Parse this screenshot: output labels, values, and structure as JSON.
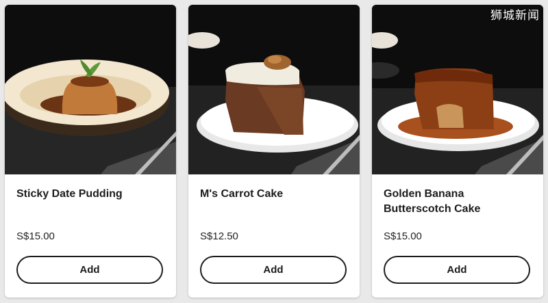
{
  "watermark": "狮城新闻",
  "products": [
    {
      "name": "Sticky Date Pudding",
      "price": "S$15.00",
      "button_label": "Add"
    },
    {
      "name": "M's Carrot Cake",
      "price": "S$12.50",
      "button_label": "Add"
    },
    {
      "name": "Golden Banana Butterscotch Cake",
      "price": "S$15.00",
      "button_label": "Add"
    }
  ],
  "colors": {
    "card_bg": "#ffffff",
    "page_bg": "#e9e9e9",
    "text": "#1c1c1c",
    "button_border": "#1c1c1c"
  }
}
